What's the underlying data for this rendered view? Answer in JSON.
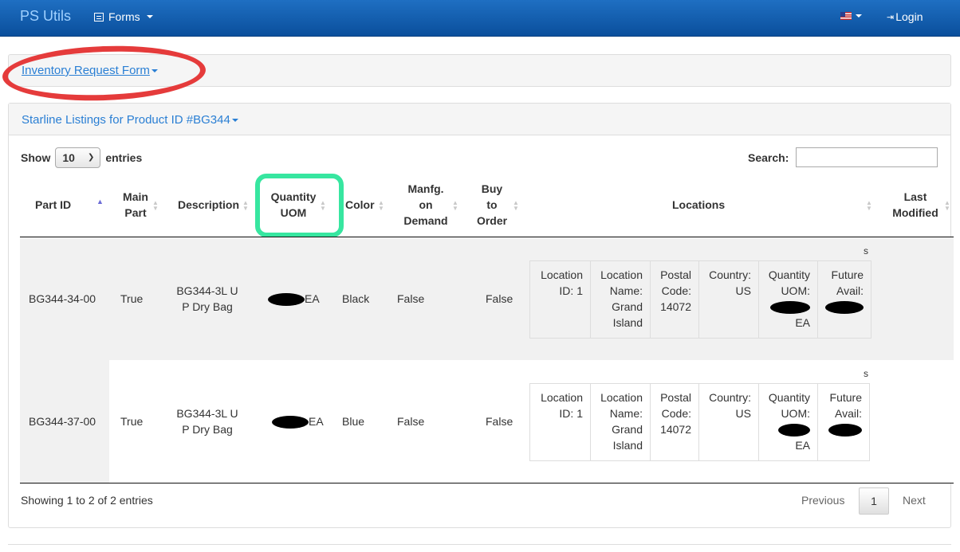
{
  "navbar": {
    "brand": "PS Utils",
    "forms_label": "Forms",
    "login_label": "Login",
    "flag_icon": "us-flag-icon",
    "forms_icon": "list-alt-icon",
    "login_icon": "sign-in-icon"
  },
  "outer_panel": {
    "title": "Inventory Request Form"
  },
  "inner_panel": {
    "title": "Starline Listings for Product ID #BG344"
  },
  "length": {
    "show_label": "Show",
    "selected": "10",
    "entries_label": "entries"
  },
  "search": {
    "label": "Search:",
    "value": ""
  },
  "columns": {
    "part_id": "Part ID",
    "main_part_1": "Main",
    "main_part_2": "Part",
    "description": "Description",
    "quantity_1": "Quantity",
    "quantity_2": "UOM",
    "color": "Color",
    "manfg_1": "Manfg.",
    "manfg_2": "on",
    "manfg_3": "Demand",
    "buy_1": "Buy",
    "buy_2": "to",
    "buy_3": "Order",
    "locations": "Locations",
    "last_modified_1": "Last",
    "last_modified_2": "Modified"
  },
  "rows": [
    {
      "part_id": "BG344-34-00",
      "main_part": "True",
      "description_1": "BG344-3L U",
      "description_2": "P Dry Bag",
      "quantity_uom": "EA",
      "color": "Black",
      "manfg": "False",
      "buy": "False",
      "s_label": "s",
      "loc": {
        "id_1": "Location",
        "id_2": "ID: 1",
        "name_1": "Location",
        "name_2": "Name:",
        "name_3": "Grand",
        "name_4": "Island",
        "postal_1": "Postal",
        "postal_2": "Code:",
        "postal_3": "14072",
        "country_1": "Country:",
        "country_2": "US",
        "qty_1": "Quantity",
        "qty_2": "UOM:",
        "qty_4": "EA",
        "future_1": "Future",
        "future_2": "Avail:"
      }
    },
    {
      "part_id": "BG344-37-00",
      "main_part": "True",
      "description_1": "BG344-3L U",
      "description_2": "P Dry Bag",
      "quantity_uom": "EA",
      "color": "Blue",
      "manfg": "False",
      "buy": "False",
      "s_label": "s",
      "loc": {
        "id_1": "Location",
        "id_2": "ID: 1",
        "name_1": "Location",
        "name_2": "Name:",
        "name_3": "Grand",
        "name_4": "Island",
        "postal_1": "Postal",
        "postal_2": "Code:",
        "postal_3": "14072",
        "country_1": "Country:",
        "country_2": "US",
        "qty_1": "Quantity",
        "qty_2": "UOM:",
        "qty_4": "EA",
        "future_1": "Future",
        "future_2": "Avail:"
      }
    }
  ],
  "footer": {
    "info": "Showing 1 to 2 of 2 entries",
    "previous": "Previous",
    "page": "1",
    "next": "Next"
  },
  "annotations": {
    "red_circle_color": "#e53b3b",
    "green_box_color": "#37e6a0"
  }
}
